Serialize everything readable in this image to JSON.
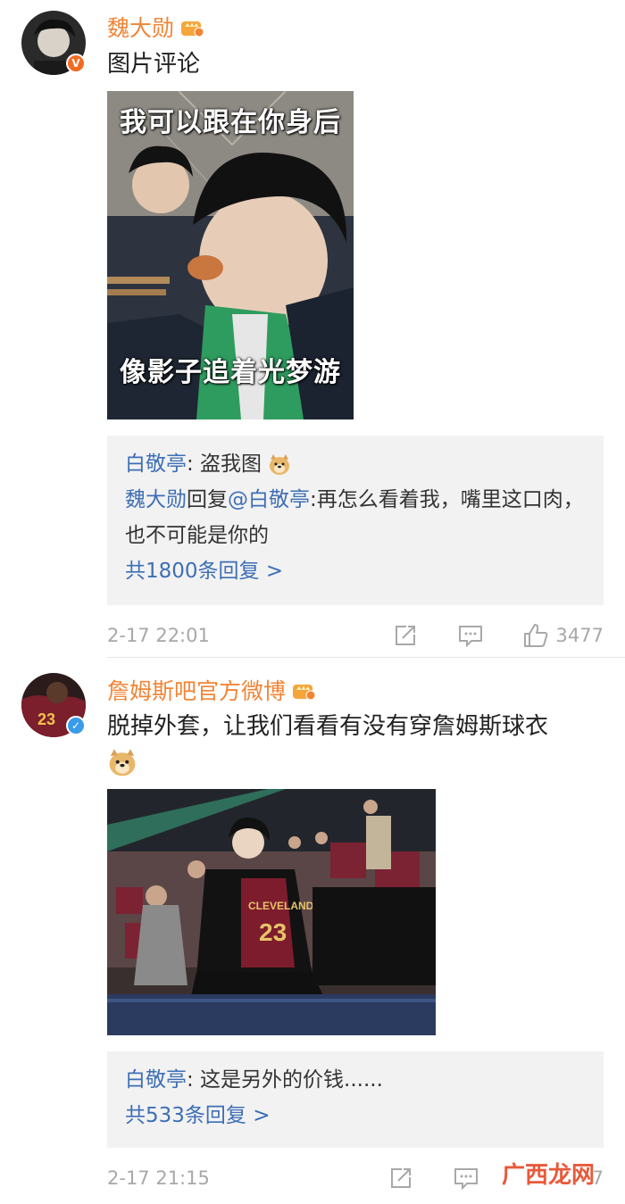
{
  "posts": [
    {
      "username": "魏大勋",
      "text": "图片评论",
      "image_caption_top": "我可以跟在你身后",
      "image_caption_bottom": "像影子追着光梦游",
      "replies": [
        {
          "author": "白敬亭",
          "sep": ":",
          "content": " 盗我图"
        },
        {
          "author": "魏大勋",
          "mid": "回复",
          "mention": "@白敬亭",
          "sep": ":",
          "content": "再怎么看着我，嘴里这口肉，也不可能是你的"
        }
      ],
      "more_replies": "共1800条回复 >",
      "timestamp": "2-17 22:01",
      "likes": "3477"
    },
    {
      "username": "詹姆斯吧官方微博",
      "text": "脱掉外套，让我们看看有没有穿詹姆斯球衣",
      "jersey_text": "CLEVELAND",
      "jersey_number": "23",
      "replies": [
        {
          "author": "白敬亭",
          "sep": ":",
          "content": " 这是另外的价钱......"
        }
      ],
      "more_replies": "共533条回复 >",
      "timestamp": "2-17 21:15",
      "likes": "7"
    }
  ],
  "watermark": "广西龙网",
  "icons": {
    "crown": "crown-icon",
    "verified": "verified-icon",
    "repost": "repost-icon",
    "comment": "comment-icon",
    "like": "like-icon",
    "doge": "doge-emoji"
  },
  "colors": {
    "username": "#f08536",
    "link": "#3e6fb5",
    "meta": "#a8a8a8",
    "reply_bg": "#f2f2f2"
  }
}
